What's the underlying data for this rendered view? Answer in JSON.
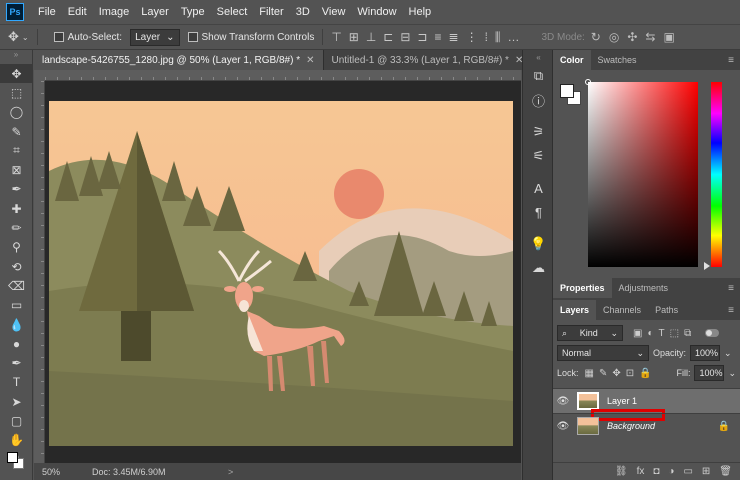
{
  "app": {
    "logo": "Ps"
  },
  "menu": [
    "File",
    "Edit",
    "Image",
    "Layer",
    "Type",
    "Select",
    "Filter",
    "3D",
    "View",
    "Window",
    "Help"
  ],
  "options": {
    "auto_select_label": "Auto-Select:",
    "auto_select_value": "Layer",
    "show_transform_label": "Show Transform Controls",
    "mode_3d_label": "3D Mode:"
  },
  "document_tabs": [
    {
      "label": "landscape-5426755_1280.jpg @ 50% (Layer 1, RGB/8#) *",
      "active": true
    },
    {
      "label": "Untitled-1 @ 33.3% (Layer 1, RGB/8#) *",
      "active": false
    }
  ],
  "status": {
    "zoom": "50%",
    "doc": "Doc: 3.45M/6.90M",
    "arrow": ">"
  },
  "color_panel": {
    "tabs": [
      "Color",
      "Swatches"
    ],
    "foreground": "#ffffff",
    "background": "#ffffff"
  },
  "properties_panel": {
    "tabs": [
      "Properties",
      "Adjustments"
    ]
  },
  "layers_panel": {
    "tabs": [
      "Layers",
      "Channels",
      "Paths"
    ],
    "kind_filter": "Kind",
    "blend_mode": "Normal",
    "opacity_label": "Opacity:",
    "opacity_value": "100%",
    "lock_label": "Lock:",
    "fill_label": "Fill:",
    "fill_value": "100%",
    "layers": [
      {
        "name": "Layer 1",
        "selected": true,
        "visible": true,
        "locked": false
      },
      {
        "name": "Background",
        "selected": false,
        "visible": true,
        "locked": true
      }
    ]
  },
  "colors": {
    "accent": "#31a8ff",
    "highlight_box": "#e00000"
  }
}
